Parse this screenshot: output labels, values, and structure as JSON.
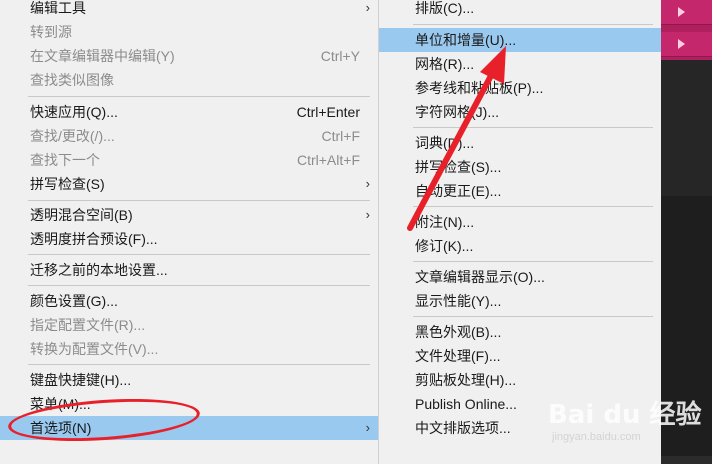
{
  "left_menu": {
    "items": [
      {
        "label": "编辑工具",
        "shortcut": "",
        "submenu": true,
        "disabled": false
      },
      {
        "label": "转到源",
        "shortcut": "",
        "submenu": false,
        "disabled": true
      },
      {
        "label": "在文章编辑器中编辑(Y)",
        "shortcut": "Ctrl+Y",
        "submenu": false,
        "disabled": true
      },
      {
        "label": "查找类似图像",
        "shortcut": "",
        "submenu": false,
        "disabled": true
      },
      {
        "label": "快速应用(Q)...",
        "shortcut": "Ctrl+Enter",
        "submenu": false,
        "disabled": false
      },
      {
        "label": "查找/更改(/)...",
        "shortcut": "Ctrl+F",
        "submenu": false,
        "disabled": true
      },
      {
        "label": "查找下一个",
        "shortcut": "Ctrl+Alt+F",
        "submenu": false,
        "disabled": true
      },
      {
        "label": "拼写检查(S)",
        "shortcut": "",
        "submenu": true,
        "disabled": false
      },
      {
        "label": "透明混合空间(B)",
        "shortcut": "",
        "submenu": true,
        "disabled": false
      },
      {
        "label": "透明度拼合预设(F)...",
        "shortcut": "",
        "submenu": false,
        "disabled": false
      },
      {
        "label": "迁移之前的本地设置...",
        "shortcut": "",
        "submenu": false,
        "disabled": false
      },
      {
        "label": "颜色设置(G)...",
        "shortcut": "",
        "submenu": false,
        "disabled": false
      },
      {
        "label": "指定配置文件(R)...",
        "shortcut": "",
        "submenu": false,
        "disabled": true
      },
      {
        "label": "转换为配置文件(V)...",
        "shortcut": "",
        "submenu": false,
        "disabled": true
      },
      {
        "label": "键盘快捷键(H)...",
        "shortcut": "",
        "submenu": false,
        "disabled": false
      },
      {
        "label": "菜单(M)...",
        "shortcut": "",
        "submenu": false,
        "disabled": false
      },
      {
        "label": "首选项(N)",
        "shortcut": "",
        "submenu": true,
        "disabled": false,
        "highlight": true
      }
    ]
  },
  "right_menu": {
    "items": [
      {
        "label": "排版(C)..."
      },
      {
        "label": "单位和增量(U)...",
        "highlight": true
      },
      {
        "label": "网格(R)..."
      },
      {
        "label": "参考线和粘贴板(P)..."
      },
      {
        "label": "字符网格(J)..."
      },
      {
        "label": "词典(D)..."
      },
      {
        "label": "拼写检查(S)..."
      },
      {
        "label": "自动更正(E)..."
      },
      {
        "label": "附注(N)..."
      },
      {
        "label": "修订(K)..."
      },
      {
        "label": "文章编辑器显示(O)..."
      },
      {
        "label": "显示性能(Y)..."
      },
      {
        "label": "黑色外观(B)..."
      },
      {
        "label": "文件处理(F)..."
      },
      {
        "label": "剪贴板处理(H)..."
      },
      {
        "label": "Publish Online..."
      },
      {
        "label": "中文排版选项..."
      }
    ]
  },
  "watermark": {
    "logo": "Bai du 经验",
    "sub": "jingyan.baidu.com"
  },
  "colors": {
    "highlight": "#99c9ef",
    "annotation": "#e8202a",
    "accent_bg": "#c4276c"
  },
  "icons": {
    "submenu_arrow": "›"
  }
}
